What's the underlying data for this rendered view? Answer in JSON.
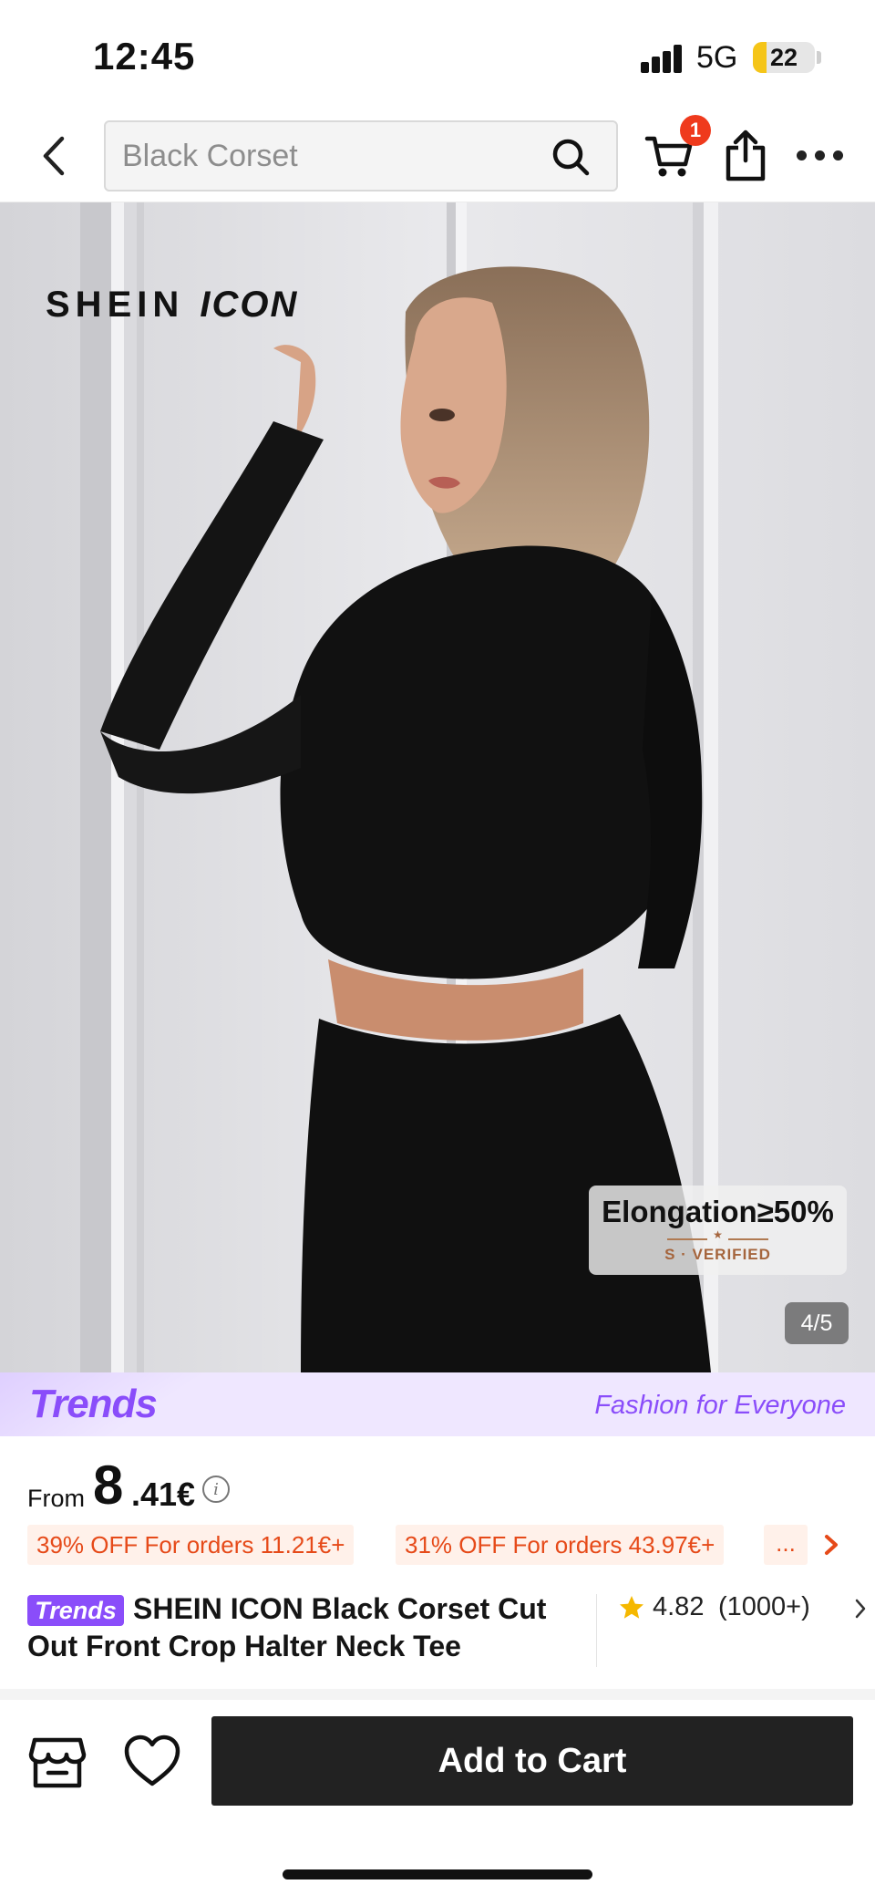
{
  "status_bar": {
    "time": "12:45",
    "network": "5G",
    "battery_level": "22",
    "battery_fill_percent": 22
  },
  "nav": {
    "search_placeholder": "Black Corset",
    "cart_badge": "1",
    "icons": [
      "chevron-left-icon",
      "search-icon",
      "cart-icon",
      "share-icon",
      "more-icon"
    ]
  },
  "hero": {
    "brand_word": "SHEIN",
    "brand_icon_word": "ICON",
    "badge_title": "Elongation≥50%",
    "badge_star": "★",
    "badge_subtitle": "S · VERIFIED",
    "pager": "4/5"
  },
  "trends_banner": {
    "logo": "Trends",
    "slogan": "Fashion for Everyone",
    "color": "#8a4dfa"
  },
  "price": {
    "prefix": "From",
    "integer": "8",
    "decimal": ".41€",
    "info_glyph": "i"
  },
  "promos": {
    "tags": [
      "39% OFF For orders 11.21€+",
      "31% OFF For orders 43.97€+"
    ],
    "more": "...",
    "accent_color": "#e64a19"
  },
  "product": {
    "chip": "Trends",
    "title": "SHEIN ICON Black Corset Cut Out Front Crop Halter Neck Tee",
    "rating": "4.82",
    "review_count": "(1000+)"
  },
  "bottom_bar": {
    "add_to_cart": "Add to Cart",
    "icons": [
      "store-icon",
      "heart-icon"
    ]
  }
}
